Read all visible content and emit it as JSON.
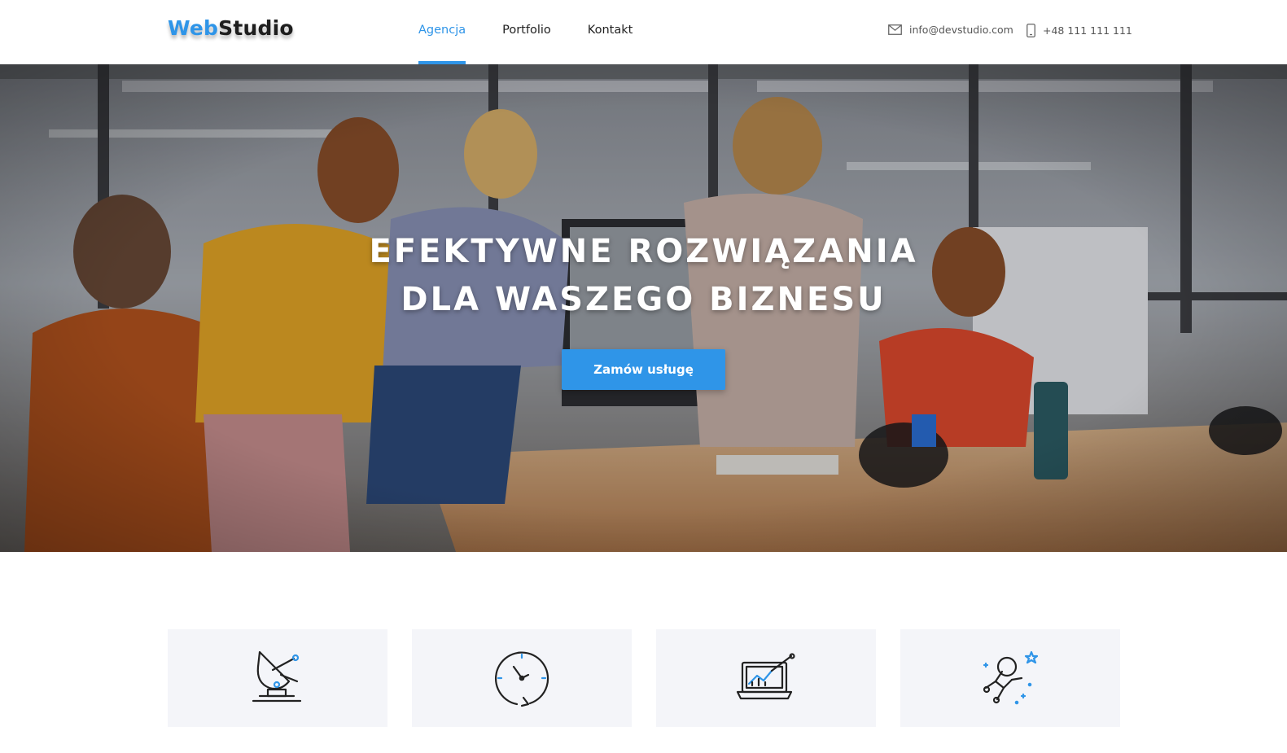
{
  "header": {
    "logo": {
      "part1": "Web",
      "part2": "Studio"
    },
    "nav": [
      {
        "label": "Agencja",
        "active": true
      },
      {
        "label": "Portfolio",
        "active": false
      },
      {
        "label": "Kontakt",
        "active": false
      }
    ],
    "contact": {
      "email": "info@devstudio.com",
      "email_icon": "envelope-icon",
      "phone": "+48 111 111 111",
      "phone_icon": "smartphone-icon"
    }
  },
  "hero": {
    "title_line1": "EFEKTYWNE ROZWIĄZANIA",
    "title_line2": "DLA WASZEGO BIZNESU",
    "cta_label": "Zamów usługę",
    "background": "office team photo"
  },
  "features": [
    {
      "icon": "satellite-dish-icon"
    },
    {
      "icon": "clock-icon"
    },
    {
      "icon": "laptop-chart-icon"
    },
    {
      "icon": "astronaut-icon"
    }
  ],
  "colors": {
    "accent": "#2f95e8",
    "card_bg": "#f4f5f9",
    "text_dark": "#222222"
  }
}
